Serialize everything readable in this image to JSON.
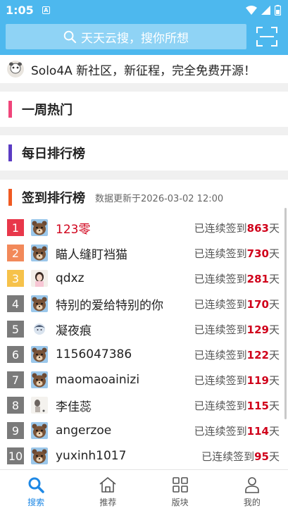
{
  "status": {
    "time": "1:05",
    "indicator": "A"
  },
  "search": {
    "placeholder": "天天云搜，搜你所想"
  },
  "notice": {
    "text": "Solo4A 新社区，新征程，完全免费开源！"
  },
  "sections": {
    "weekly": {
      "title": "一周热门",
      "color": "#f0457a"
    },
    "daily": {
      "title": "每日排行榜",
      "color": "#5b3cc4"
    },
    "checkin": {
      "title": "签到排行榜",
      "subtitle": "数据更新于2026-03-02 12:00",
      "color": "#f05a22"
    }
  },
  "rank_prefix": "已连续签到",
  "rank_suffix": "天",
  "rankings": [
    {
      "rank": "1",
      "name": "123零",
      "days": "863",
      "badge": "#e8374a",
      "name_color": "#d0021b",
      "avatar": "bear"
    },
    {
      "rank": "2",
      "name": "瞄人缝盯裆猫",
      "days": "730",
      "badge": "#f2895a",
      "name_color": "#222",
      "avatar": "bear"
    },
    {
      "rank": "3",
      "name": "qdxz",
      "days": "281",
      "badge": "#f6c24a",
      "name_color": "#222",
      "avatar": "girl"
    },
    {
      "rank": "4",
      "name": "特别的爱给特别的你",
      "days": "170",
      "badge": "#7a7a7a",
      "name_color": "#222",
      "avatar": "bear"
    },
    {
      "rank": "5",
      "name": "凝夜痕",
      "days": "129",
      "badge": "#7a7a7a",
      "name_color": "#222",
      "avatar": "anime"
    },
    {
      "rank": "6",
      "name": "1156047386",
      "days": "122",
      "badge": "#7a7a7a",
      "name_color": "#222",
      "avatar": "bear"
    },
    {
      "rank": "7",
      "name": "maomaoainizi",
      "days": "119",
      "badge": "#7a7a7a",
      "name_color": "#222",
      "avatar": "bear"
    },
    {
      "rank": "8",
      "name": "李佳蕊",
      "days": "115",
      "badge": "#7a7a7a",
      "name_color": "#222",
      "avatar": "photo"
    },
    {
      "rank": "9",
      "name": "angerzoe",
      "days": "114",
      "badge": "#7a7a7a",
      "name_color": "#222",
      "avatar": "bear"
    },
    {
      "rank": "10",
      "name": "yuxinh1017",
      "days": "95",
      "badge": "#7a7a7a",
      "name_color": "#222",
      "avatar": "bear"
    }
  ],
  "nav": [
    {
      "label": "搜索",
      "icon": "search-icon",
      "active": true
    },
    {
      "label": "推荐",
      "icon": "home-icon",
      "active": false
    },
    {
      "label": "版块",
      "icon": "grid-icon",
      "active": false
    },
    {
      "label": "我的",
      "icon": "user-icon",
      "active": false
    }
  ],
  "colors": {
    "header": "#4db8ee",
    "accent": "#1e88e5",
    "days": "#d0021b"
  }
}
